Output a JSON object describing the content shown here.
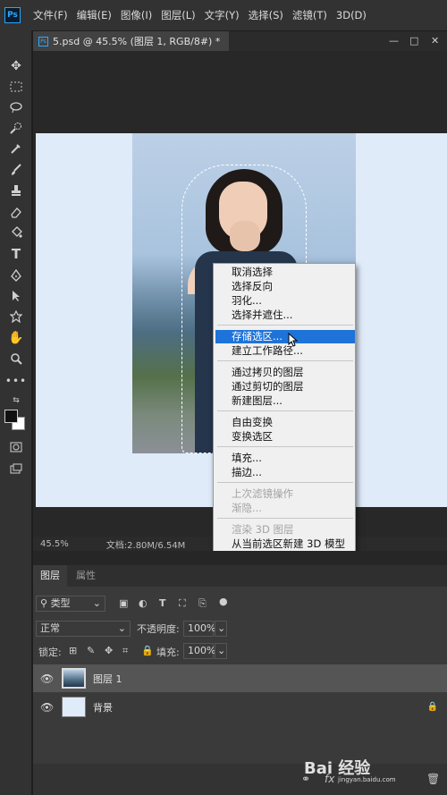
{
  "app": {
    "logo": "Ps"
  },
  "menubar": {
    "items": [
      "文件(F)",
      "编辑(E)",
      "图像(I)",
      "图层(L)",
      "文字(Y)",
      "选择(S)",
      "滤镜(T)",
      "3D(D)"
    ]
  },
  "toolbar": {
    "tools": [
      "move-icon",
      "marquee-icon",
      "lasso-icon",
      "quick-select-icon",
      "eyedropper-icon",
      "brush-icon",
      "stamp-icon",
      "eraser-icon",
      "paint-bucket-icon",
      "type-icon",
      "pen-icon",
      "path-select-icon",
      "shape-icon",
      "hand-icon",
      "zoom-icon",
      "more-icon"
    ]
  },
  "document": {
    "tab_title": "5.psd @ 45.5% (图层 1, RGB/8#) *"
  },
  "status": {
    "zoom": "45.5%",
    "doc_size": "文档:2.80M/6.54M"
  },
  "context_menu": {
    "group1": [
      "取消选择",
      "选择反向",
      "羽化...",
      "选择并遮住..."
    ],
    "group2": [
      "存储选区...",
      "建立工作路径..."
    ],
    "group3": [
      "通过拷贝的图层",
      "通过剪切的图层",
      "新建图层..."
    ],
    "group4": [
      "自由变换",
      "变换选区"
    ],
    "group5": [
      "填充...",
      "描边..."
    ],
    "group6": [
      "上次滤镜操作",
      "渐隐..."
    ],
    "group7": [
      "渲染 3D 图层",
      "从当前选区新建 3D 模型"
    ],
    "highlighted": "存储选区..."
  },
  "layers_panel": {
    "tabs": [
      "图层",
      "属性"
    ],
    "filter_kind": "类型",
    "blend_mode": "正常",
    "opacity_label": "不透明度:",
    "opacity_value": "100%",
    "lock_label": "锁定:",
    "fill_label": "填充:",
    "fill_value": "100%",
    "layers": [
      {
        "name": "图层 1",
        "selected": true
      },
      {
        "name": "背景",
        "selected": false
      }
    ]
  },
  "watermark": {
    "text": "Bai 经验",
    "sub": "jingyan.baidu.com"
  },
  "colors": {
    "accent": "#1e73d8",
    "menubar": "#323232",
    "panel": "#3a3a3a"
  }
}
